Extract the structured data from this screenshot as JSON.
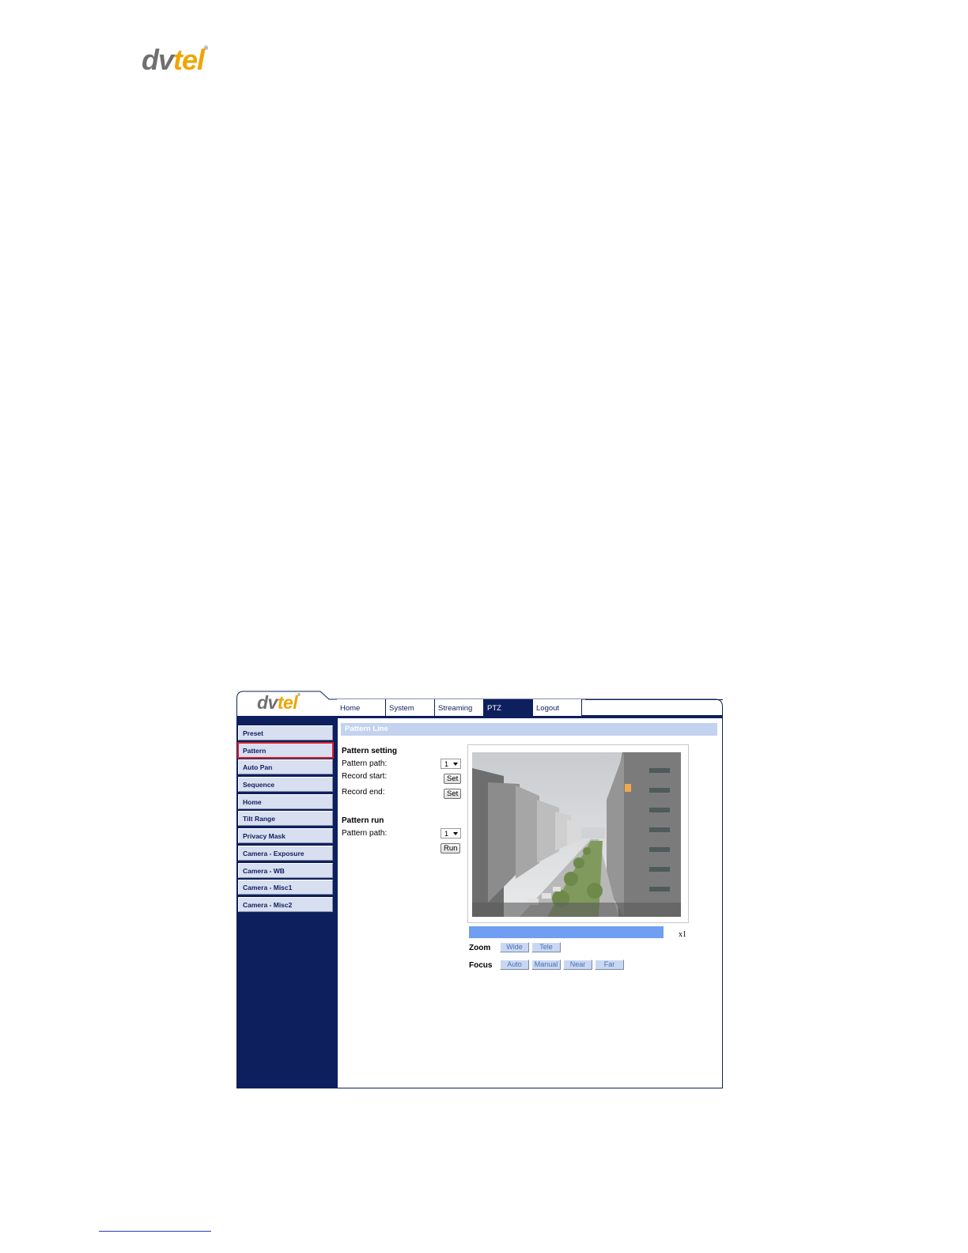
{
  "page": {
    "logo_dv": "dv",
    "logo_tel": "tel",
    "logo_tm": "®"
  },
  "app": {
    "logo_dv": "dv",
    "logo_tel": "tel",
    "logo_tm": "®",
    "tabs": [
      {
        "label": "Home",
        "active": false
      },
      {
        "label": "System",
        "active": false
      },
      {
        "label": "Streaming",
        "active": false
      },
      {
        "label": "PTZ",
        "active": true
      },
      {
        "label": "Logout",
        "active": false
      }
    ],
    "sidebar": [
      {
        "label": "Preset"
      },
      {
        "label": "Pattern",
        "selected": true
      },
      {
        "label": "Auto Pan"
      },
      {
        "label": "Sequence"
      },
      {
        "label": "Home"
      },
      {
        "label": "Tilt Range"
      },
      {
        "label": "Privacy Mask"
      },
      {
        "label": "Camera - Exposure"
      },
      {
        "label": "Camera - WB"
      },
      {
        "label": "Camera - Misc1"
      },
      {
        "label": "Camera - Misc2"
      }
    ],
    "section_title": "Pattern Line",
    "pattern_setting": {
      "heading": "Pattern setting",
      "path_label": "Pattern path:",
      "path_value": "1",
      "record_start_label": "Record start:",
      "record_start_button": "Set",
      "record_end_label": "Record end:",
      "record_end_button": "Set"
    },
    "pattern_run": {
      "heading": "Pattern run",
      "path_label": "Pattern path:",
      "path_value": "1",
      "run_button": "Run"
    },
    "zoom_level": "x1",
    "zoom": {
      "label": "Zoom",
      "wide": "Wide",
      "tele": "Tele"
    },
    "focus": {
      "label": "Focus",
      "auto": "Auto",
      "manual": "Manual",
      "near": "Near",
      "far": "Far"
    },
    "colors": {
      "navy": "#0d1f5c",
      "section_bar": "#c3d2ee",
      "zoom_bar": "#6f9ef2",
      "selected_outline": "#d6202b"
    }
  }
}
